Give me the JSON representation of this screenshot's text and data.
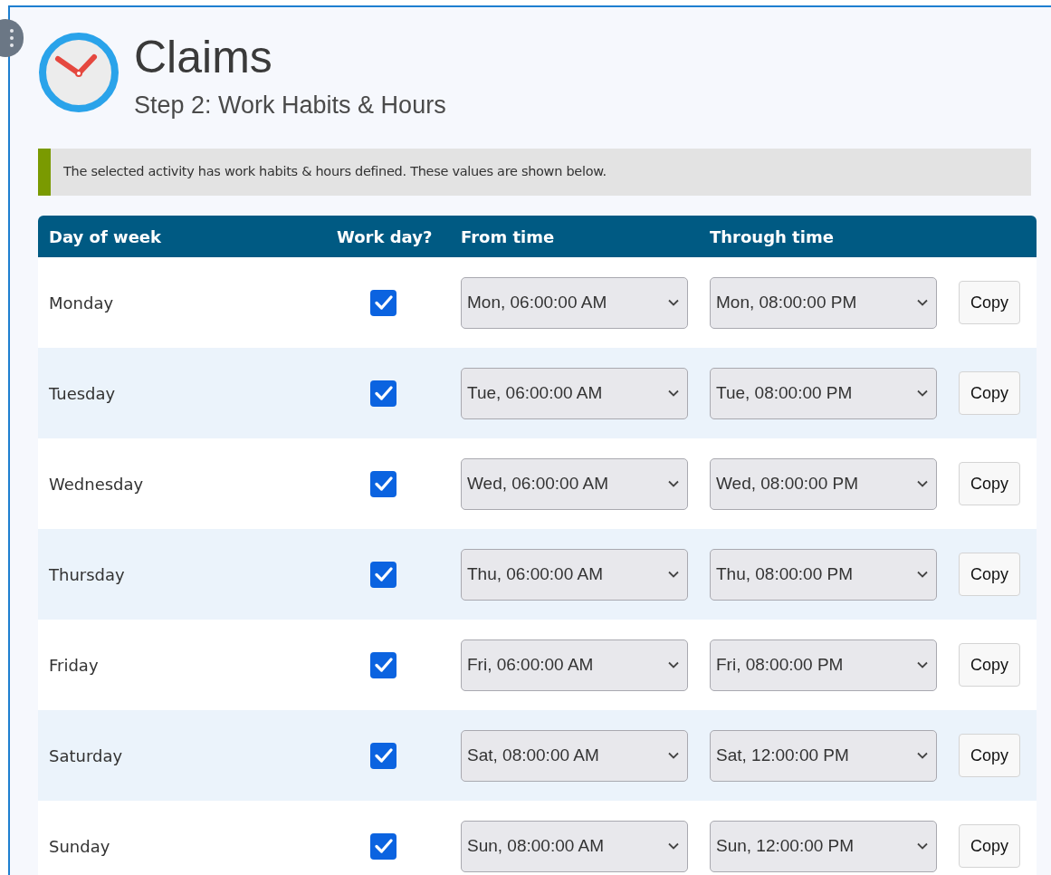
{
  "header": {
    "title": "Claims",
    "subtitle": "Step 2: Work Habits & Hours"
  },
  "notice": "The selected activity has work habits & hours defined. These values are shown below.",
  "table": {
    "columns": [
      "Day of week",
      "Work day?",
      "From time",
      "Through time"
    ],
    "rows": [
      {
        "day": "Monday",
        "work_day": true,
        "from": "Mon, 06:00:00 AM",
        "through": "Mon, 08:00:00 PM",
        "action": "Copy"
      },
      {
        "day": "Tuesday",
        "work_day": true,
        "from": "Tue, 06:00:00 AM",
        "through": "Tue, 08:00:00 PM",
        "action": "Copy"
      },
      {
        "day": "Wednesday",
        "work_day": true,
        "from": "Wed, 06:00:00 AM",
        "through": "Wed, 08:00:00 PM",
        "action": "Copy"
      },
      {
        "day": "Thursday",
        "work_day": true,
        "from": "Thu, 06:00:00 AM",
        "through": "Thu, 08:00:00 PM",
        "action": "Copy"
      },
      {
        "day": "Friday",
        "work_day": true,
        "from": "Fri, 06:00:00 AM",
        "through": "Fri, 08:00:00 PM",
        "action": "Copy"
      },
      {
        "day": "Saturday",
        "work_day": true,
        "from": "Sat, 08:00:00 AM",
        "through": "Sat, 12:00:00 PM",
        "action": "Copy"
      },
      {
        "day": "Sunday",
        "work_day": true,
        "from": "Sun, 08:00:00 AM",
        "through": "Sun, 12:00:00 PM",
        "action": "Copy"
      }
    ]
  }
}
